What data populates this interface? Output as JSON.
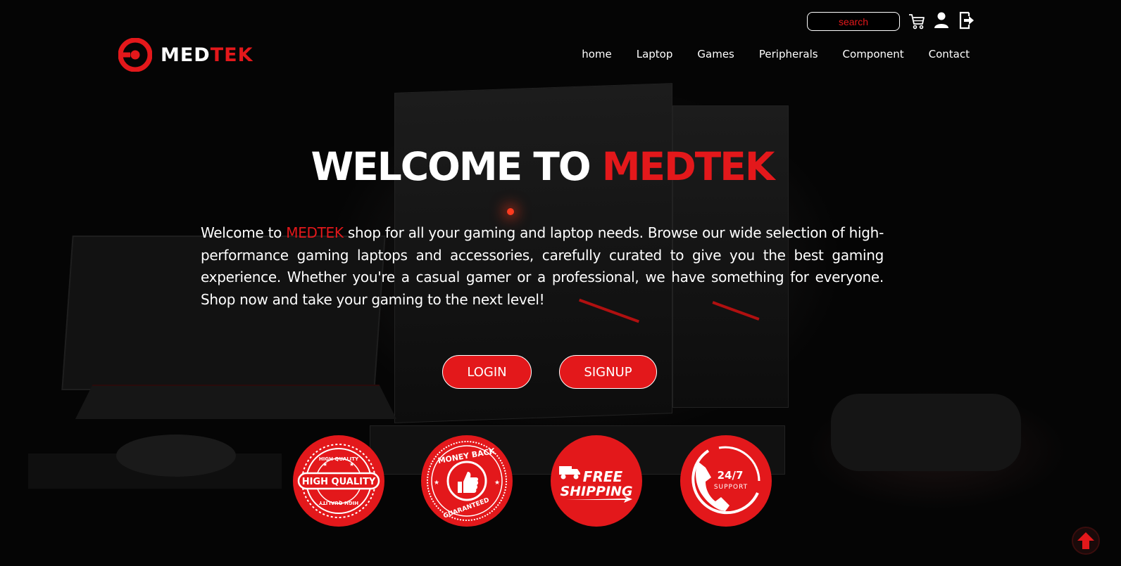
{
  "header": {
    "search": {
      "placeholder": "search",
      "value": ""
    },
    "icons": [
      "cart-icon",
      "user-icon",
      "logout-icon"
    ],
    "logo": {
      "text_white": "MED",
      "text_red": "TEK"
    }
  },
  "nav": {
    "items": [
      {
        "label": "home"
      },
      {
        "label": "Laptop"
      },
      {
        "label": "Games"
      },
      {
        "label": "Peripherals"
      },
      {
        "label": "Component"
      },
      {
        "label": "Contact"
      }
    ]
  },
  "hero": {
    "title_white": "WELCOME TO ",
    "title_red": "MEDTEK",
    "intro_prefix": "Welcome to ",
    "intro_brand": "MEDTEK",
    "intro_rest": " shop for all your gaming and laptop needs. Browse our wide selection of high-performance gaming laptops and accessories, carefully curated to give you the best gaming experience. Whether you're a casual gamer or a professional, we have something for everyone. Shop now and take your gaming to the next level!",
    "login_label": "LOGIN",
    "signup_label": "SIGNUP"
  },
  "badges": [
    {
      "icon": "high-quality-icon",
      "label": "HIGH QUALITY",
      "ring_text": "HIGH QUALITY"
    },
    {
      "icon": "money-back-icon",
      "label_top": "MONEY BACK",
      "label_bottom": "GUARANTEED"
    },
    {
      "icon": "free-shipping-icon",
      "label_top": "FREE",
      "label_bottom": "SHIPPING"
    },
    {
      "icon": "support-icon",
      "label_top": "24/7",
      "label_bottom": "SUPPORT"
    }
  ],
  "colors": {
    "accent": "#e3181b",
    "background": "#050505",
    "text": "#ffffff"
  }
}
